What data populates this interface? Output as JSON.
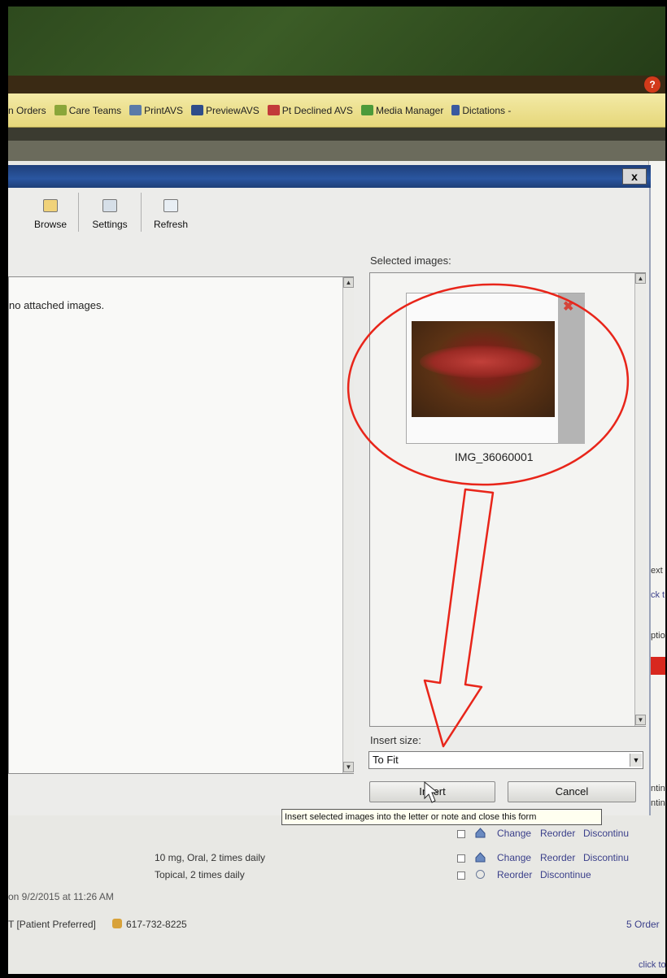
{
  "help_badge": "?",
  "toolbar": {
    "items": [
      {
        "label": "n Orders",
        "icon": "orders-icon"
      },
      {
        "label": "Care Teams",
        "icon": "care-teams-icon"
      },
      {
        "label": "PrintAVS",
        "icon": "print-icon"
      },
      {
        "label": "PreviewAVS",
        "icon": "preview-icon"
      },
      {
        "label": "Pt Declined AVS",
        "icon": "declined-icon"
      },
      {
        "label": "Media Manager",
        "icon": "media-manager-icon"
      },
      {
        "label": "Dictations -",
        "icon": "dictations-icon"
      }
    ]
  },
  "dialog": {
    "close_label": "x",
    "buttons": {
      "browse": "Browse",
      "settings": "Settings",
      "refresh": "Refresh"
    },
    "left_message": "no attached images.",
    "selected_images_label": "Selected images:",
    "image_name": "IMG_36060001",
    "remove_icon": "✖",
    "insert_size_label": "Insert size:",
    "insert_size_value": "To Fit",
    "insert_button": "Insert",
    "cancel_button": "Cancel",
    "tooltip": "Insert selected images into the letter or note and close this form"
  },
  "background": {
    "right_edge_fragments": [
      "ext",
      "ck t",
      "ptio",
      "ntin",
      "ntin"
    ],
    "med_rows": [
      {
        "sig": "",
        "actions": [
          "Change",
          "Reorder",
          "Discontinu"
        ]
      },
      {
        "sig": "10 mg, Oral, 2 times daily",
        "actions": [
          "Change",
          "Reorder",
          "Discontinu"
        ]
      },
      {
        "sig": "Topical, 2 times daily",
        "actions": [
          "Reorder",
          "Discontinue"
        ]
      }
    ],
    "timestamp": "on 9/2/2015 at 11:26 AM",
    "phone_label": "T [Patient Preferred]",
    "phone_number": "617-732-8225",
    "order_link": "5 Order",
    "click_link": "click to"
  },
  "colors": {
    "titlebar": "#2a56a0",
    "toolbar": "#efe39a",
    "annotation_red": "#e8251a",
    "alert_red": "#d8281e"
  }
}
